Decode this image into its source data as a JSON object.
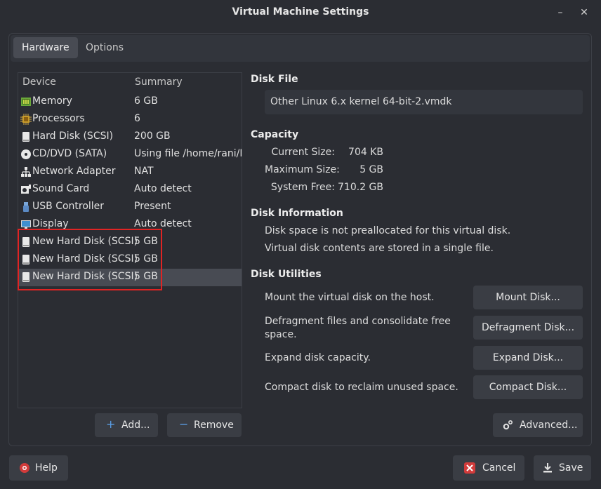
{
  "window": {
    "title": "Virtual Machine Settings",
    "minimize_glyph": "–",
    "close_glyph": "✕"
  },
  "tabs": [
    {
      "label": "Hardware",
      "active": true
    },
    {
      "label": "Options",
      "active": false
    }
  ],
  "device_list": {
    "col_device": "Device",
    "col_summary": "Summary",
    "rows": [
      {
        "icon": "memory-icon",
        "name": "Memory",
        "summary": "6 GB"
      },
      {
        "icon": "processor-icon",
        "name": "Processors",
        "summary": "6"
      },
      {
        "icon": "hard-disk-icon",
        "name": "Hard Disk (SCSI)",
        "summary": "200 GB"
      },
      {
        "icon": "cd-dvd-icon",
        "name": "CD/DVD (SATA)",
        "summary": "Using file /home/rani/D"
      },
      {
        "icon": "network-icon",
        "name": "Network Adapter",
        "summary": "NAT"
      },
      {
        "icon": "sound-card-icon",
        "name": "Sound Card",
        "summary": "Auto detect"
      },
      {
        "icon": "usb-icon",
        "name": "USB Controller",
        "summary": "Present"
      },
      {
        "icon": "display-icon",
        "name": "Display",
        "summary": "Auto detect"
      },
      {
        "icon": "hard-disk-icon",
        "name": "New Hard Disk (SCSI)",
        "summary": "5 GB"
      },
      {
        "icon": "hard-disk-icon",
        "name": "New Hard Disk (SCSI)",
        "summary": "5 GB"
      },
      {
        "icon": "hard-disk-icon",
        "name": "New Hard Disk (SCSI)",
        "summary": "5 GB",
        "selected": true
      }
    ]
  },
  "list_buttons": {
    "add": "Add...",
    "remove": "Remove"
  },
  "disk_file": {
    "title": "Disk File",
    "value": "Other Linux 6.x kernel 64-bit-2.vmdk"
  },
  "capacity": {
    "title": "Capacity",
    "current_label": "Current Size:",
    "current_value": "704 KB",
    "max_label": "Maximum Size:",
    "max_value": "5 GB",
    "free_label": "System Free:",
    "free_value": "710.2 GB"
  },
  "disk_info": {
    "title": "Disk Information",
    "line1": "Disk space is not preallocated for this virtual disk.",
    "line2": "Virtual disk contents are stored in a single file."
  },
  "utilities": {
    "title": "Disk Utilities",
    "mount_text": "Mount the virtual disk on the host.",
    "mount_btn": "Mount Disk...",
    "defrag_text1": "Defragment files and consolidate free",
    "defrag_text2": "space.",
    "defrag_btn": "Defragment Disk...",
    "expand_text": "Expand disk capacity.",
    "expand_btn": "Expand Disk...",
    "compact_text": "Compact disk to reclaim unused space.",
    "compact_btn": "Compact Disk..."
  },
  "advanced_btn": "Advanced...",
  "footer": {
    "help": "Help",
    "cancel": "Cancel",
    "save": "Save"
  },
  "colors": {
    "highlight_border": "#e02424",
    "selected_row": "#484b53",
    "add_icon": "#5a9ee6",
    "remove_icon": "#5a9ee6",
    "cancel_icon": "#d23b3b"
  }
}
